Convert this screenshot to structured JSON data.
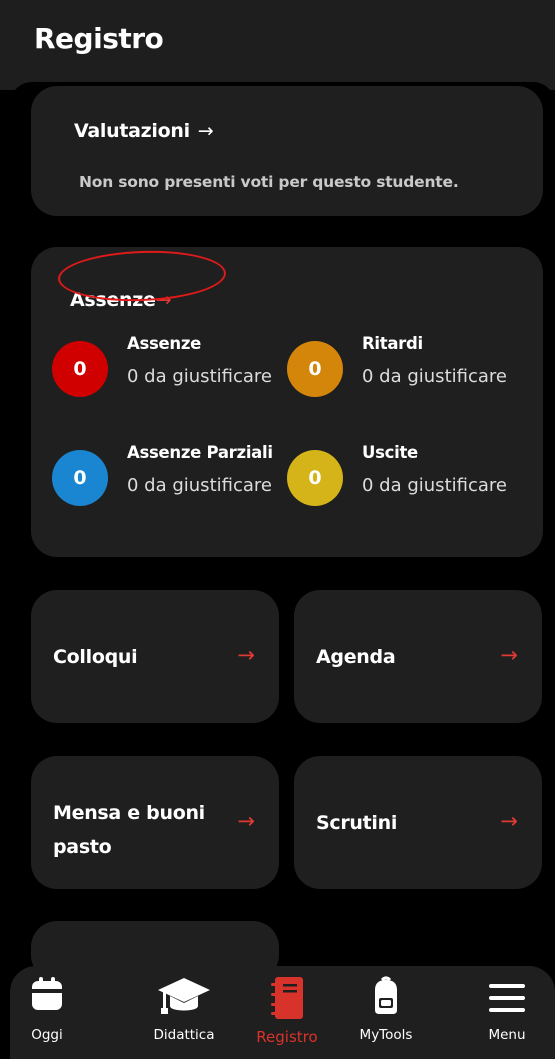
{
  "header": {
    "title": "Registro"
  },
  "valutazioni": {
    "title": "Valutazioni",
    "arrow": "→",
    "empty_text": "Non sono presenti voti per questo studente."
  },
  "assenze": {
    "title": "Assenze",
    "arrow": "→",
    "stats": [
      {
        "count": "0",
        "label": "Assenze",
        "sub": "0 da giustificare",
        "color": "#d10000"
      },
      {
        "count": "0",
        "label": "Ritardi",
        "sub": "0 da giustificare",
        "color": "#d4860a"
      },
      {
        "count": "0",
        "label": "Assenze Parziali",
        "sub": "0 da giustificare",
        "color": "#1a86d1"
      },
      {
        "count": "0",
        "label": "Uscite",
        "sub": "0 da giustificare",
        "color": "#d4b419"
      }
    ]
  },
  "tiles": {
    "colloqui": "Colloqui",
    "agenda": "Agenda",
    "mensa": "Mensa e buoni pasto",
    "scrutini": "Scrutini",
    "arrow": "→"
  },
  "nav": [
    {
      "label": "Oggi",
      "icon": "calendar-icon"
    },
    {
      "label": "Didattica",
      "icon": "graduation-cap-icon"
    },
    {
      "label": "Registro",
      "icon": "notebook-icon",
      "active": true
    },
    {
      "label": "MyTools",
      "icon": "backpack-icon"
    },
    {
      "label": "Menu",
      "icon": "hamburger-menu-icon"
    }
  ],
  "colors": {
    "accent": "#e03a34",
    "card": "#1f1f1f",
    "background": "#000000"
  }
}
